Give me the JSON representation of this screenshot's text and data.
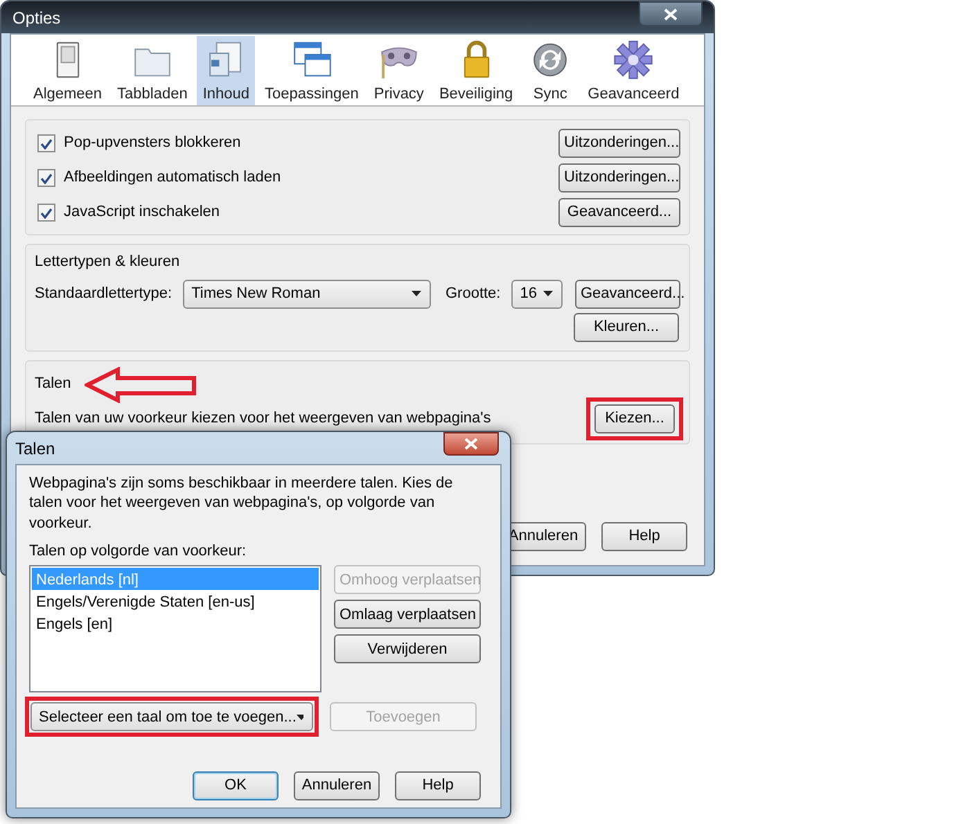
{
  "window": {
    "title": "Opties"
  },
  "categories": [
    {
      "label": "Algemeen",
      "selected": false
    },
    {
      "label": "Tabbladen",
      "selected": false
    },
    {
      "label": "Inhoud",
      "selected": true
    },
    {
      "label": "Toepassingen",
      "selected": false
    },
    {
      "label": "Privacy",
      "selected": false
    },
    {
      "label": "Beveiliging",
      "selected": false
    },
    {
      "label": "Sync",
      "selected": false
    },
    {
      "label": "Geavanceerd",
      "selected": false
    }
  ],
  "content_options": [
    {
      "label": "Pop-upvensters blokkeren",
      "checked": true,
      "button": "Uitzonderingen..."
    },
    {
      "label": "Afbeeldingen automatisch laden",
      "checked": true,
      "button": "Uitzonderingen..."
    },
    {
      "label": "JavaScript inschakelen",
      "checked": true,
      "button": "Geavanceerd..."
    }
  ],
  "fonts": {
    "heading": "Lettertypen & kleuren",
    "font_label": "Standaardlettertype:",
    "font_value": "Times New Roman",
    "size_label": "Grootte:",
    "size_value": "16",
    "advanced_button": "Geavanceerd...",
    "colors_button": "Kleuren..."
  },
  "languages": {
    "heading": "Talen",
    "description": "Talen van uw voorkeur kiezen voor het weergeven van webpagina's",
    "button": "Kiezen..."
  },
  "footer_buttons": [
    "Annuleren",
    "Help"
  ],
  "dialog": {
    "title": "Talen",
    "intro": "Webpagina's zijn soms beschikbaar in meerdere talen. Kies de talen voor het weergeven van webpagina's, op volgorde van voorkeur.",
    "list_label": "Talen op volgorde van voorkeur:",
    "languages": [
      {
        "label": "Nederlands  [nl]",
        "selected": true
      },
      {
        "label": "Engels/Verenigde Staten  [en-us]",
        "selected": false
      },
      {
        "label": "Engels  [en]",
        "selected": false
      }
    ],
    "side_buttons": [
      {
        "label": "Omhoog verplaatsen",
        "disabled": true
      },
      {
        "label": "Omlaag verplaatsen",
        "disabled": false
      },
      {
        "label": "Verwijderen",
        "disabled": false
      }
    ],
    "add_select": {
      "value": "Selecteer een taal om toe te voegen..."
    },
    "add_button": {
      "label": "Toevoegen",
      "disabled": true
    },
    "buttons": [
      {
        "label": "OK",
        "default": true
      },
      {
        "label": "Annuleren",
        "default": false
      },
      {
        "label": "Help",
        "default": false
      }
    ]
  }
}
